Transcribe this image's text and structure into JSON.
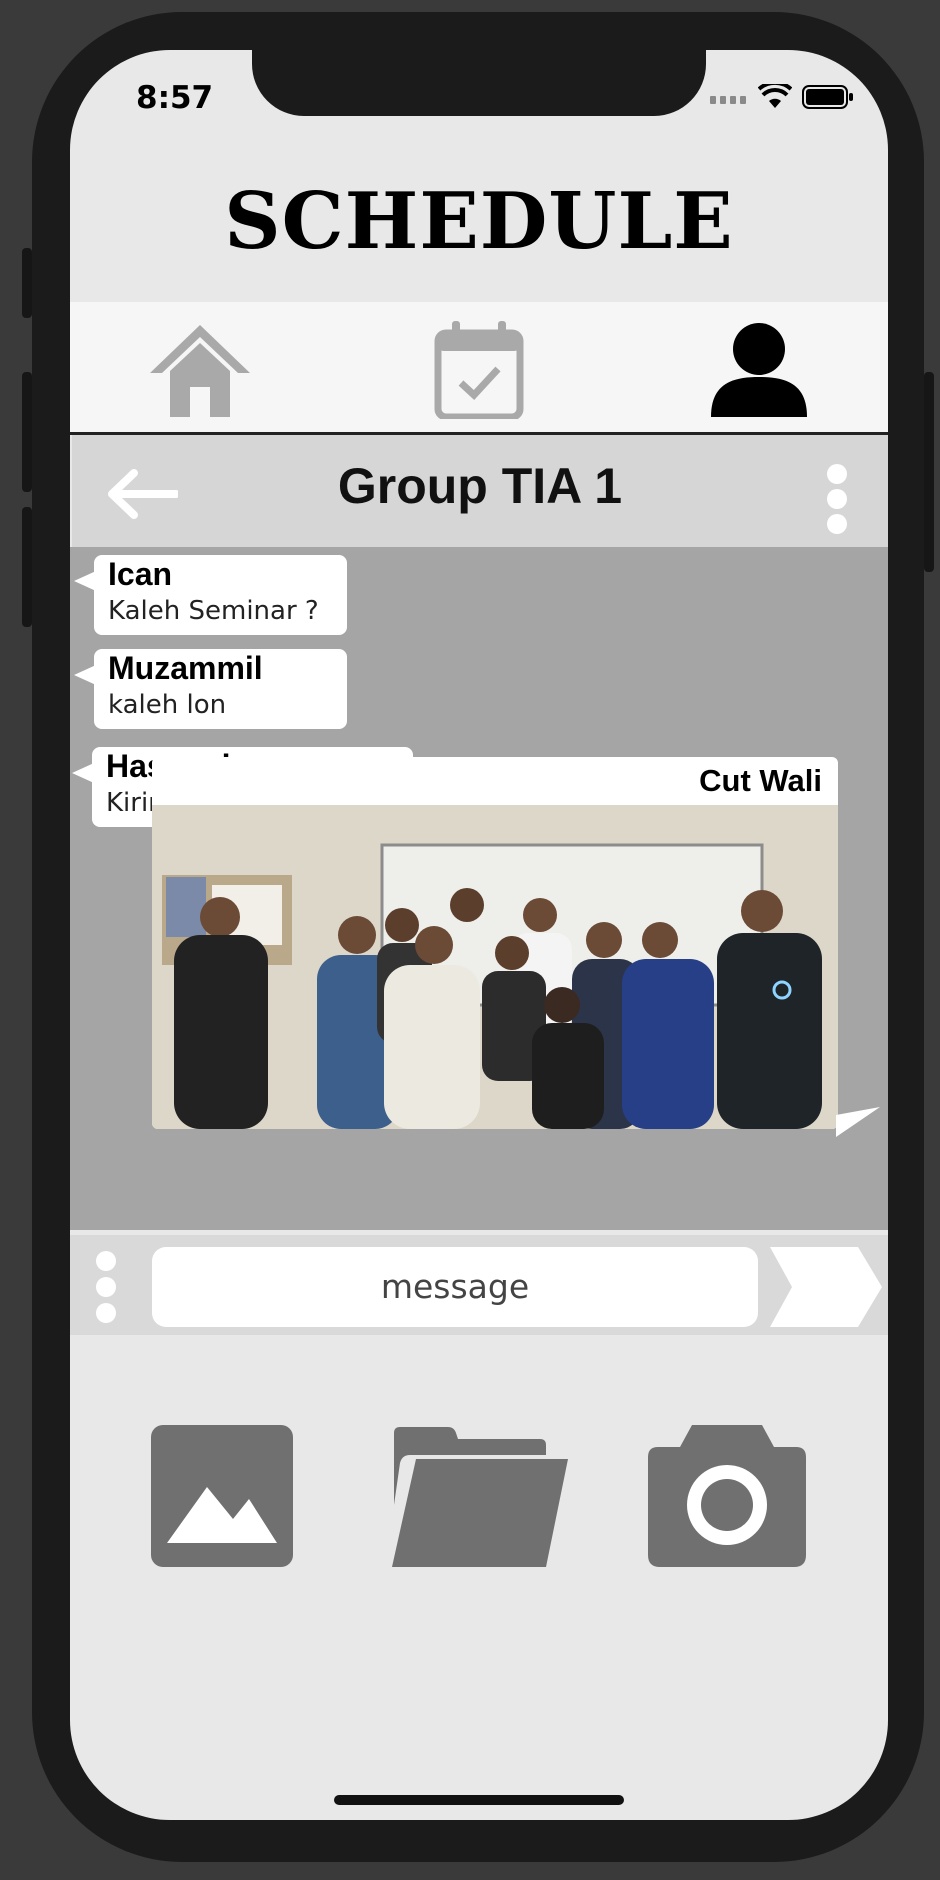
{
  "status_bar": {
    "time": "8:57"
  },
  "app": {
    "title": "SCHEDULE"
  },
  "nav": {
    "items": [
      "home-icon",
      "calendar-check-icon",
      "user-icon"
    ],
    "active": "user-icon"
  },
  "chat": {
    "group_name": "Group TIA 1",
    "messages": [
      {
        "sender": "Ican",
        "text": "Kaleh Seminar ?"
      },
      {
        "sender": "Muzammil",
        "text": "kaleh lon"
      },
      {
        "sender": "Hasanul",
        "text": "Kirim foto seminar le"
      }
    ],
    "photo_message": {
      "sender": "Cut Wali"
    }
  },
  "composer": {
    "placeholder": "message"
  },
  "attachments": [
    "image-icon",
    "folder-icon",
    "camera-icon"
  ],
  "colors": {
    "chat_bg": "#a5a5a5",
    "icon_gray": "#707070",
    "header_bg": "#d6d6d6"
  }
}
